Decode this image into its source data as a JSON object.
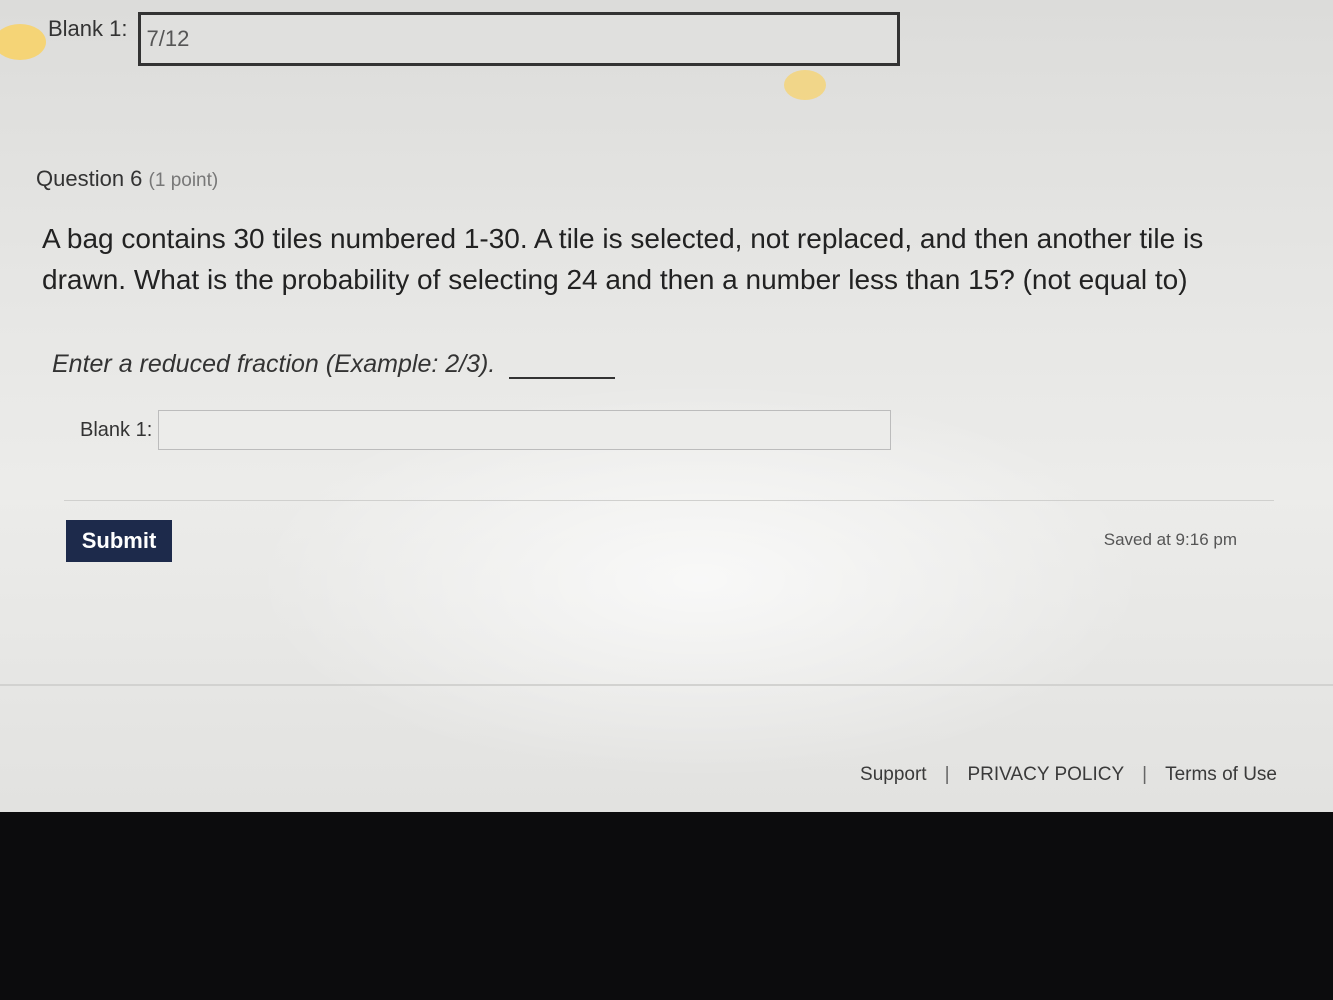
{
  "previous_question": {
    "blank_label": "Blank 1:",
    "blank_value": "7/12"
  },
  "question": {
    "number_label": "Question 6",
    "points": "(1 point)",
    "text": "A bag contains 30 tiles numbered 1-30.  A tile is selected, not replaced, and then another tile is drawn.  What is the probability of selecting 24 and then a number less than 15? (not equal to)",
    "instruction": "Enter a reduced fraction (Example: 2/3).",
    "blank_label": "Blank 1:",
    "blank_value": ""
  },
  "actions": {
    "submit_label": "Submit",
    "saved_status": "Saved at 9:16 pm"
  },
  "footer": {
    "support": "Support",
    "separator": "|",
    "privacy": "PRIVACY POLICY",
    "terms": "Terms of Use"
  },
  "colors": {
    "submit_bg": "#1d2a4b",
    "page_bg": "#e6e6e4",
    "bezel": "#0c0c0d"
  }
}
